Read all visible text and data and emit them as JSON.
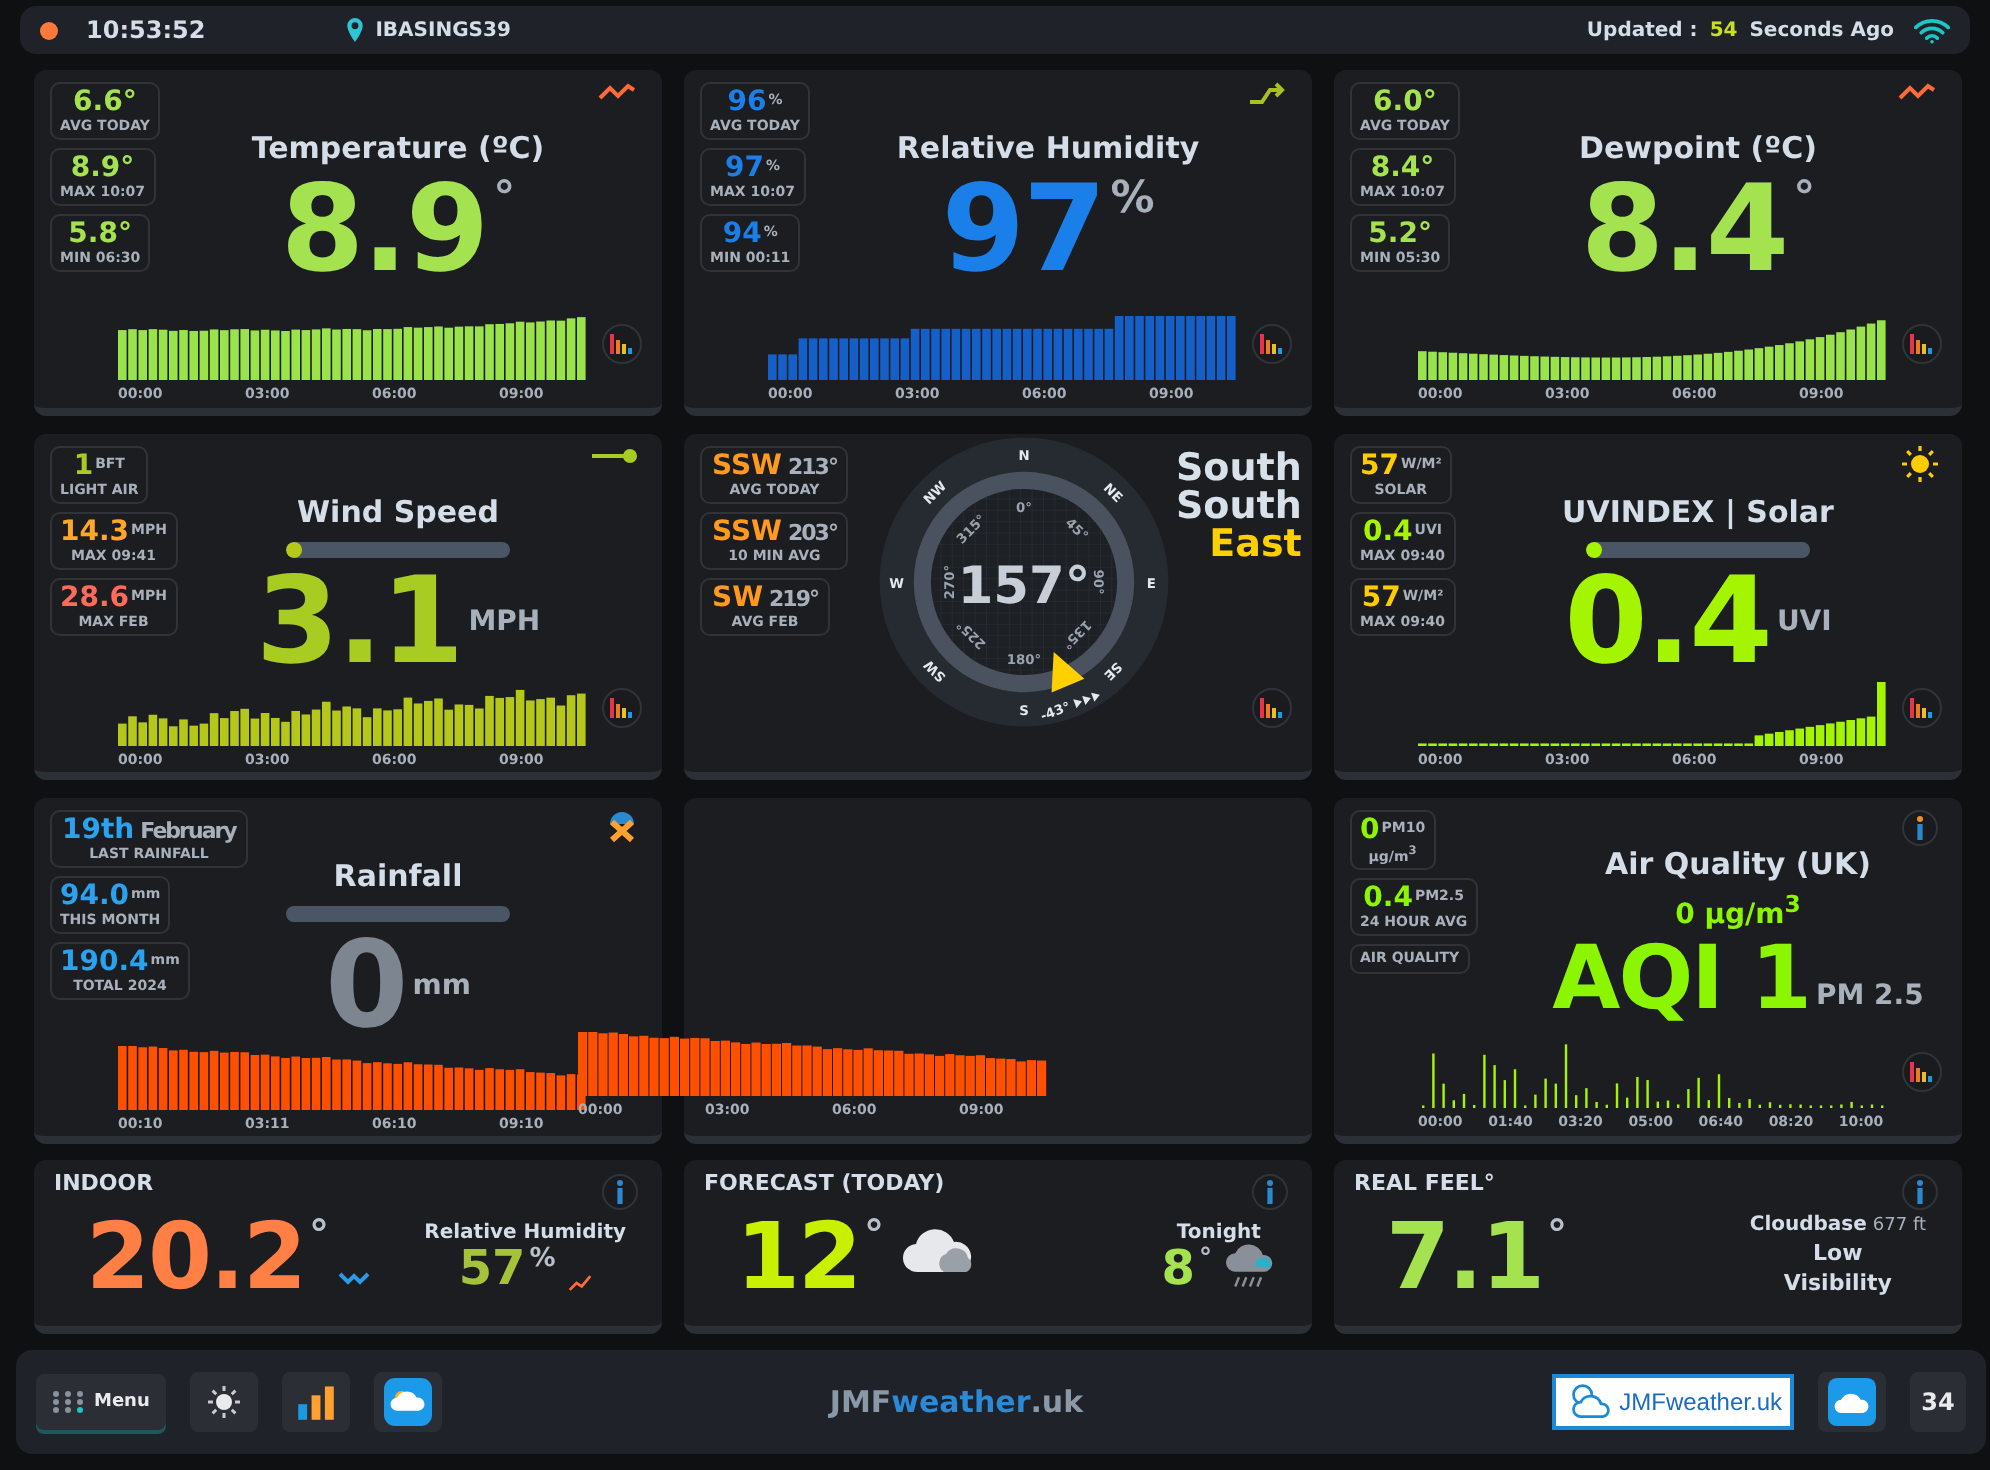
{
  "status_bar": {
    "time": "10:53:52",
    "station": "IBASINGS39",
    "updated_label": "Updated :",
    "updated_count": "54",
    "updated_suffix": "Seconds Ago"
  },
  "panels": [
    {
      "kind": "reading",
      "title": "Temperature (ºC)",
      "value": "8.9",
      "unit": "°",
      "time_labels": [
        "00:00",
        "03:00",
        "06:00",
        "09:00"
      ],
      "stats": [
        {
          "kind": "small-unit",
          "value": "6.6°",
          "label": "AVG TODAY",
          "color": "#a4e34f"
        },
        {
          "kind": "small-unit",
          "value": "8.9°",
          "label": "MAX 10:07",
          "color": "#a4e34f"
        },
        {
          "kind": "small-unit",
          "value": "5.8°",
          "label": "MIN 06:30",
          "color": "#a4e34f"
        }
      ]
    },
    {
      "kind": "reading",
      "title": "Relative Humidity",
      "value": "97",
      "unit": "%",
      "time_labels": [
        "00:00",
        "03:00",
        "06:00",
        "09:00"
      ],
      "stats": [
        {
          "kind": "small-unit",
          "value": "96",
          "unit": "%",
          "label": "AVG TODAY",
          "color": "#1a7fe8"
        },
        {
          "kind": "small-unit",
          "value": "97",
          "unit": "%",
          "label": "MAX 10:07",
          "color": "#1a7fe8"
        },
        {
          "kind": "small-unit",
          "value": "94",
          "unit": "%",
          "label": "MIN 00:11",
          "color": "#1a7fe8"
        }
      ]
    },
    {
      "kind": "reading",
      "title": "Dewpoint (ºC)",
      "value": "8.4",
      "unit": "°",
      "time_labels": [
        "00:00",
        "03:00",
        "06:00",
        "09:00"
      ],
      "stats": [
        {
          "kind": "small-unit",
          "value": "6.0°",
          "label": "AVG TODAY",
          "color": "#a4e34f"
        },
        {
          "kind": "small-unit",
          "value": "8.4°",
          "label": "MAX 10:07",
          "color": "#a4e34f"
        },
        {
          "kind": "small-unit",
          "value": "5.2°",
          "label": "MIN 05:30",
          "color": "#a4e34f"
        }
      ]
    },
    {
      "kind": "reading",
      "title": "Wind Speed",
      "level": 0.05,
      "value": "3.1",
      "unit": "MPH",
      "time_labels": [
        "00:00",
        "03:00",
        "06:00",
        "09:00"
      ],
      "stats": [
        {
          "kind": "small-unit",
          "value": "1",
          "unit": "BFT",
          "label": "LIGHT AIR",
          "color": "#a8cc22"
        },
        {
          "kind": "small-unit",
          "value": "14.3",
          "unit": "MPH",
          "label": "MAX 09:41",
          "color": "#ffa726"
        },
        {
          "kind": "small-unit",
          "value": "28.6",
          "unit": "MPH",
          "label": "MAX FEB",
          "color": "#ff6b5b"
        }
      ]
    },
    {
      "kind": "compass",
      "bearing": "157°",
      "change": "-43°",
      "cardinals": [
        "N",
        "NE",
        "E",
        "SE",
        "S",
        "SW",
        "W",
        "NW"
      ],
      "degrees": [
        "0°",
        "45°",
        "90°",
        "135°",
        "180°",
        "225°",
        "270°",
        "315°"
      ],
      "direction": [
        {
          "text": "South",
          "accent": false
        },
        {
          "text": "South",
          "accent": false
        },
        {
          "text": "East",
          "accent": true
        }
      ],
      "stats": [
        {
          "kind": "large-unit",
          "value": "SSW",
          "unit": "213°",
          "label": "AVG TODAY",
          "color": "#ff9a1f"
        },
        {
          "kind": "large-unit",
          "value": "SSW",
          "unit": "203°",
          "label": "10 MIN AVG",
          "color": "#ff9a1f"
        },
        {
          "kind": "large-unit",
          "value": "SW",
          "unit": "219°",
          "label": "AVG FEB",
          "color": "#ff9a1f"
        }
      ]
    },
    {
      "kind": "reading",
      "title": "UVINDEX | Solar",
      "level": 0.05,
      "value": "0.4",
      "unit": "UVI",
      "time_labels": [
        "00:00",
        "03:00",
        "06:00",
        "09:00"
      ],
      "stats": [
        {
          "kind": "small-unit",
          "value": "57",
          "unit": "W/M²",
          "label": "SOLAR",
          "color": "#ffcc00"
        },
        {
          "kind": "small-unit",
          "value": "0.4",
          "unit": "UVI",
          "label": "MAX 09:40",
          "color": "#a6f500"
        },
        {
          "kind": "small-unit",
          "value": "57",
          "unit": "W/M²",
          "label": "MAX 09:40",
          "color": "#ffcc00"
        }
      ]
    },
    {
      "kind": "reading",
      "title": "Rainfall",
      "level": 0,
      "value": "0",
      "unit": "mm",
      "time_labels": [
        "00:10",
        "03:11",
        "06:10",
        "09:10"
      ],
      "overflow_labels": [
        "00:00",
        "03:00",
        "06:00",
        "09:00"
      ],
      "stats": [
        {
          "kind": "large-unit",
          "value": "19th",
          "unit": "February",
          "label": "LAST RAINFALL",
          "color": "#29a3f0"
        },
        {
          "kind": "small-unit",
          "value": "94.0",
          "unit": "mm",
          "label": "THIS MONTH",
          "color": "#29a3f0"
        },
        {
          "kind": "small-unit",
          "value": "190.4",
          "unit": "mm",
          "label": "TOTAL 2024",
          "color": "#29a3f0"
        }
      ]
    },
    {
      "kind": "blank"
    },
    {
      "kind": "reading",
      "title": "Air Quality (UK)",
      "subtitle": "0 µg/m$^{3}$",
      "value": "AQI 1",
      "unit": "PM 2.5",
      "time_labels": [
        "00:00",
        "01:40",
        "03:20",
        "05:00",
        "06:40",
        "08:20",
        "10:00"
      ],
      "stats": [
        {
          "kind": "small-unit",
          "value": "0",
          "unit": "PM10",
          "label": "µg/m$^{3}$",
          "color": "#8cf500"
        },
        {
          "kind": "small-unit",
          "value": "0.4",
          "unit": "PM2.5",
          "label": "24 HOUR AVG",
          "color": "#8cf500"
        },
        {
          "kind": "small-unit",
          "label": "AIR QUALITY"
        }
      ]
    }
  ],
  "summary": [
    {
      "title": "INDOOR",
      "value": "20.2",
      "unit": "°",
      "side": {
        "label": "Relative Humidity",
        "value": "57",
        "unit": "%"
      }
    },
    {
      "title": "FORECAST (TODAY)",
      "value": "12",
      "unit": "°",
      "side": {
        "label": "Tonight",
        "value": "8",
        "unit": "°"
      }
    },
    {
      "title": "REAL FEEL°",
      "value": "7.1",
      "unit": "°",
      "side": {
        "label": "Cloudbase",
        "note": "677 ft",
        "text": "Low Visibility"
      }
    }
  ],
  "footer": {
    "menu": "Menu",
    "brand": [
      {
        "text": "JMF",
        "accent": false
      },
      {
        "text": "weather",
        "accent": true
      },
      {
        "text": ".uk",
        "accent": false
      }
    ],
    "logo": "JMFweather.uk",
    "calendar": "34"
  }
}
